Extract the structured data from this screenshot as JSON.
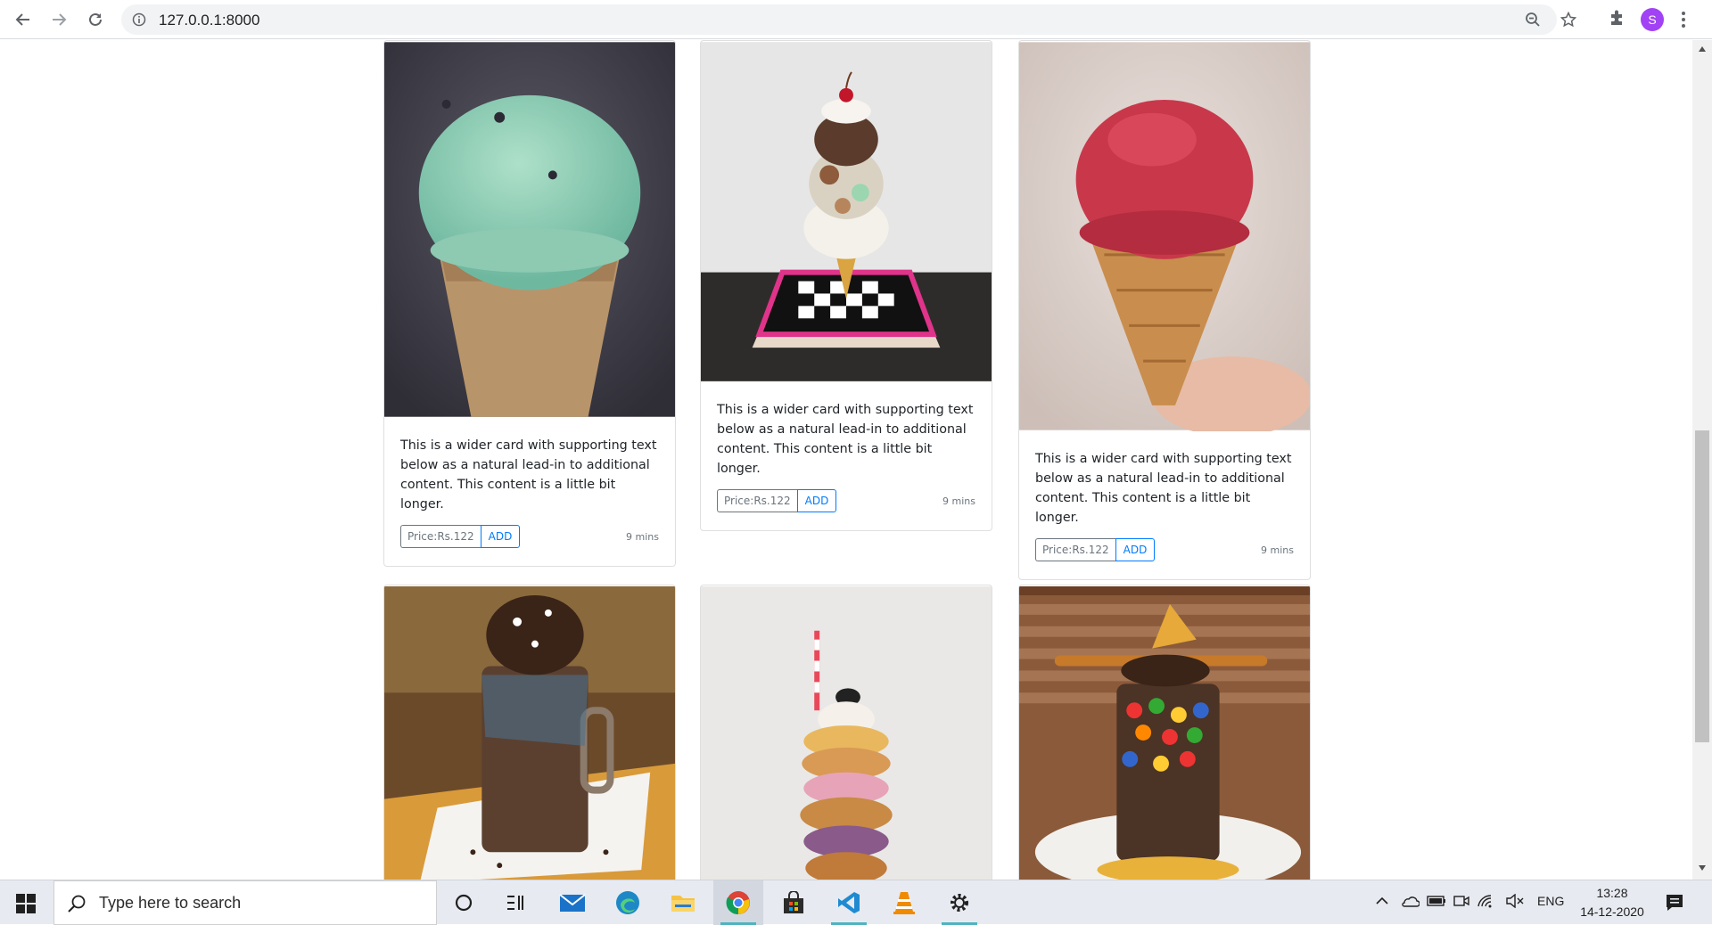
{
  "browser": {
    "url": "127.0.0.1:8000",
    "profile_initial": "S"
  },
  "cards": [
    {
      "text": "This is a wider card with supporting text below as a natural lead-in to additional content. This content is a little bit longer.",
      "price_label": "Price:Rs.122",
      "add_label": "ADD",
      "time": "9 mins",
      "image": "mint-ice-cream-cone"
    },
    {
      "text": "This is a wider card with supporting text below as a natural lead-in to additional content. This content is a little bit longer.",
      "price_label": "Price:Rs.122",
      "add_label": "ADD",
      "time": "9 mins",
      "image": "tall-sundae-cone"
    },
    {
      "text": "This is a wider card with supporting text below as a natural lead-in to additional content. This content is a little bit longer.",
      "price_label": "Price:Rs.122",
      "add_label": "ADD",
      "time": "9 mins",
      "image": "red-ice-cream-cone"
    },
    {
      "image": "chocolate-freakshake"
    },
    {
      "image": "donut-stack-shake"
    },
    {
      "image": "candy-freakshake"
    }
  ],
  "taskbar": {
    "search_placeholder": "Type here to search",
    "language": "ENG",
    "time": "13:28",
    "date": "14-12-2020",
    "apps": [
      "cortana",
      "task-view",
      "mail",
      "edge",
      "file-explorer",
      "chrome",
      "store",
      "vscode",
      "vlc",
      "settings"
    ]
  },
  "colors": {
    "accent": "#007bff",
    "secondary": "#6c757d",
    "profile": "#a142f4"
  }
}
